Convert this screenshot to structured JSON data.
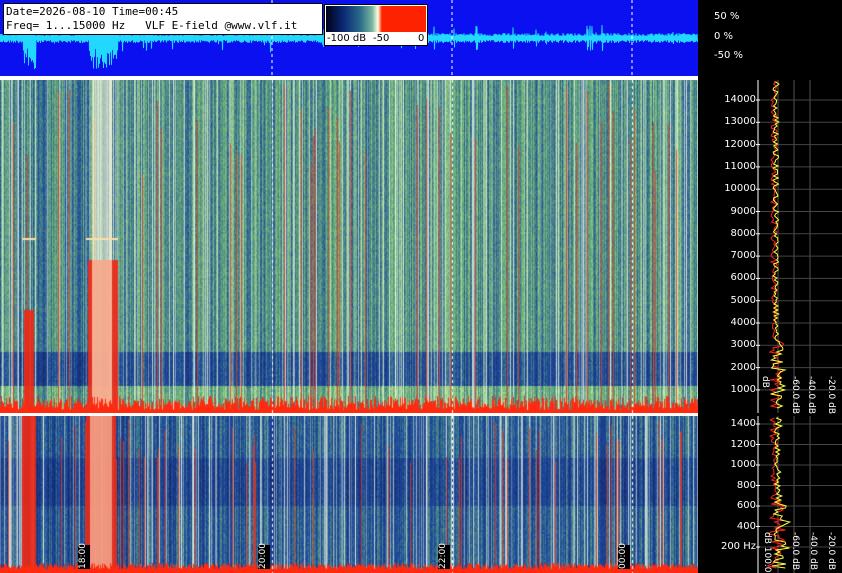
{
  "header": {
    "date_line": "Date=2026-08-10 Time=00:45",
    "freq_line": "Freq= 1...15000 Hz   VLF E-field @www.vlf.it"
  },
  "colorbar": {
    "labels": [
      "-100 dB",
      "-50",
      "0"
    ]
  },
  "waveform_axis": {
    "labels": [
      "50 %",
      "0 %",
      "-50 %"
    ]
  },
  "freq_axis_main": {
    "labels": [
      "14000",
      "13000",
      "12000",
      "11000",
      "10000",
      "9000",
      "8000",
      "7000",
      "6000",
      "5000",
      "4000",
      "3000",
      "2000",
      "1000"
    ]
  },
  "freq_axis_low": {
    "labels": [
      "1400",
      "1200",
      "1000",
      "800",
      "600",
      "400",
      "200 Hz"
    ]
  },
  "db_axis_main": {
    "labels": [
      "dB",
      "-60.0 dB",
      "-40.0 dB",
      "-20.0 dB"
    ]
  },
  "db_axis_low": {
    "labels": [
      "dB 100.0",
      "-60.0 dB",
      "-40.0 dB",
      "-20.0 dB"
    ]
  },
  "time_axis": {
    "labels": [
      "18:00",
      "20:00",
      "22:00",
      "00:00"
    ]
  },
  "colors": {
    "waveform_bg": "#0a10f0",
    "waveform_trace": "#22d8ff",
    "spectrum_yellow": "#ffff40",
    "spectrum_red": "#ff2020"
  }
}
